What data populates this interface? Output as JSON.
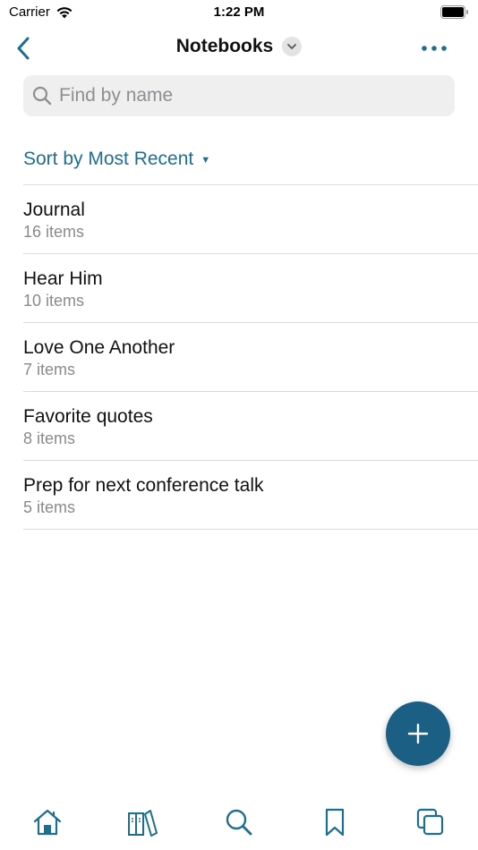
{
  "status_bar": {
    "carrier": "Carrier",
    "time": "1:22 PM"
  },
  "nav": {
    "title": "Notebooks",
    "back_icon": "chevron-left-icon",
    "more_icon": "ellipsis-icon"
  },
  "search": {
    "placeholder": "Find by name",
    "value": ""
  },
  "sort": {
    "label": "Sort by Most Recent"
  },
  "notebooks": [
    {
      "title": "Journal",
      "count": "16 items"
    },
    {
      "title": "Hear Him",
      "count": "10 items"
    },
    {
      "title": "Love One Another",
      "count": "7 items"
    },
    {
      "title": "Favorite quotes",
      "count": "8 items"
    },
    {
      "title": "Prep for next conference talk",
      "count": "5 items"
    }
  ],
  "tab_bar": {
    "items": [
      "home-icon",
      "library-icon",
      "search-icon",
      "bookmark-icon",
      "windows-icon"
    ]
  },
  "colors": {
    "accent": "#1e6f8f",
    "fab": "#1b5f84",
    "secondary_text": "#8a8a8e",
    "search_bg": "#efefef"
  }
}
